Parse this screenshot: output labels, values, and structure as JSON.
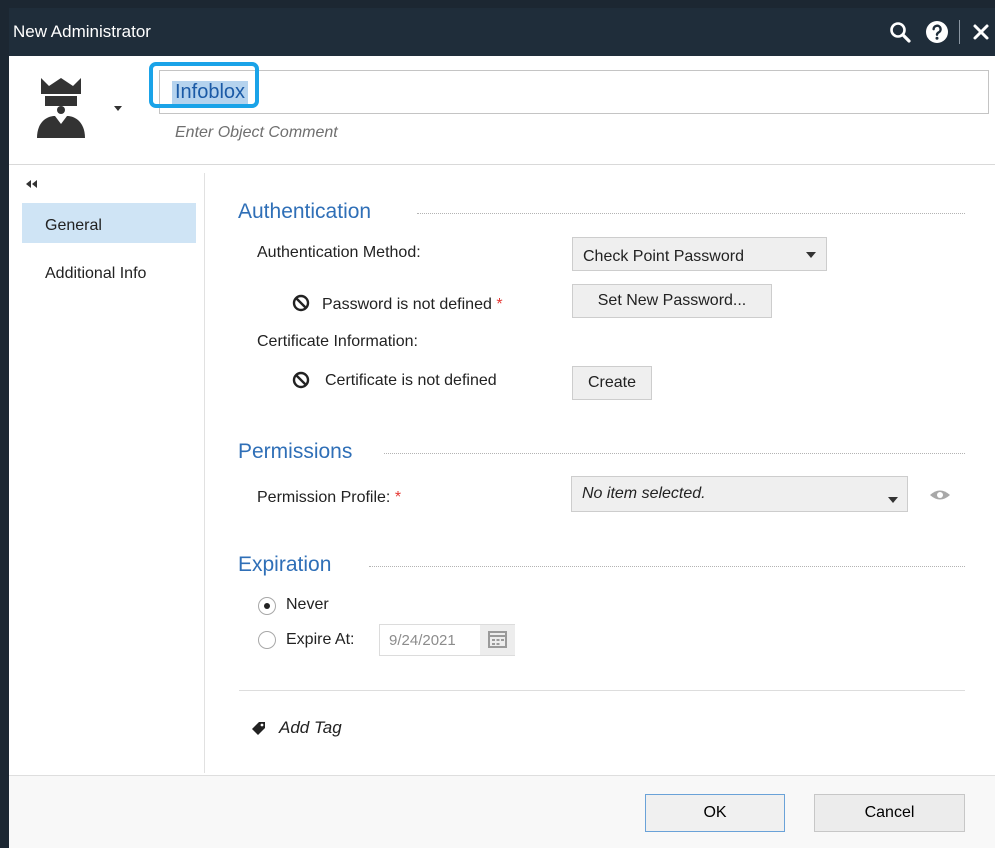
{
  "window": {
    "title": "New Administrator"
  },
  "titlebar": {
    "icons": [
      "search-icon",
      "help-icon",
      "close-icon"
    ]
  },
  "header": {
    "name_value": "Infoblox",
    "comment_placeholder": "Enter Object Comment",
    "avatar_icon": "admin-crown-icon"
  },
  "sidebar": {
    "collapse_icon": "double-chevron-left-icon",
    "items": [
      {
        "label": "General",
        "active": true
      },
      {
        "label": "Additional Info",
        "active": false
      }
    ]
  },
  "authentication": {
    "title": "Authentication",
    "method_label": "Authentication Method:",
    "method_value": "Check Point Password",
    "password_status": "Password is not defined",
    "set_password_button": "Set New Password...",
    "certificate_label": "Certificate Information:",
    "certificate_status": "Certificate is not defined",
    "create_button": "Create"
  },
  "permissions": {
    "title": "Permissions",
    "profile_label": "Permission Profile:",
    "profile_value": "No item selected."
  },
  "expiration": {
    "title": "Expiration",
    "never_label": "Never",
    "expire_label": "Expire At:",
    "date_value": "9/24/2021",
    "selected": "never"
  },
  "tag": {
    "label": "Add Tag"
  },
  "footer": {
    "ok_label": "OK",
    "cancel_label": "Cancel"
  },
  "colors": {
    "titlebar": "#1f2d3a",
    "section_title": "#2f6fb7",
    "required": "#e53935",
    "nav_active": "#cfe4f5",
    "focus_ring": "#1aa3e8"
  }
}
